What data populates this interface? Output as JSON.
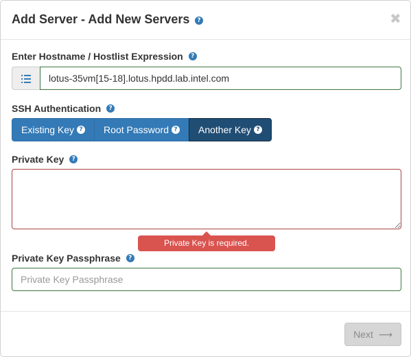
{
  "modal": {
    "title": "Add Server - Add New Servers",
    "help_glyph": "?",
    "close_glyph": "✖"
  },
  "hostname": {
    "label": "Enter Hostname / Hostlist Expression",
    "value": "lotus-35vm[15-18].lotus.hpdd.lab.intel.com",
    "addon_icon": "list-icon"
  },
  "ssh": {
    "label": "SSH Authentication",
    "options": [
      {
        "label": "Existing Key",
        "active": false
      },
      {
        "label": "Root Password",
        "active": false
      },
      {
        "label": "Another Key",
        "active": true
      }
    ]
  },
  "private_key": {
    "label": "Private Key",
    "value": "",
    "error": "Private Key is required."
  },
  "passphrase": {
    "label": "Private Key Passphrase",
    "placeholder": "Private Key Passphrase",
    "value": ""
  },
  "footer": {
    "next_label": "Next",
    "next_icon": "arrow-right-icon",
    "next_glyph": "⟶"
  },
  "colors": {
    "primary": "#337ab7",
    "primary_active": "#204d74",
    "success_border": "#3c763d",
    "error_border": "#a94442",
    "error_tooltip": "#d9534f"
  }
}
